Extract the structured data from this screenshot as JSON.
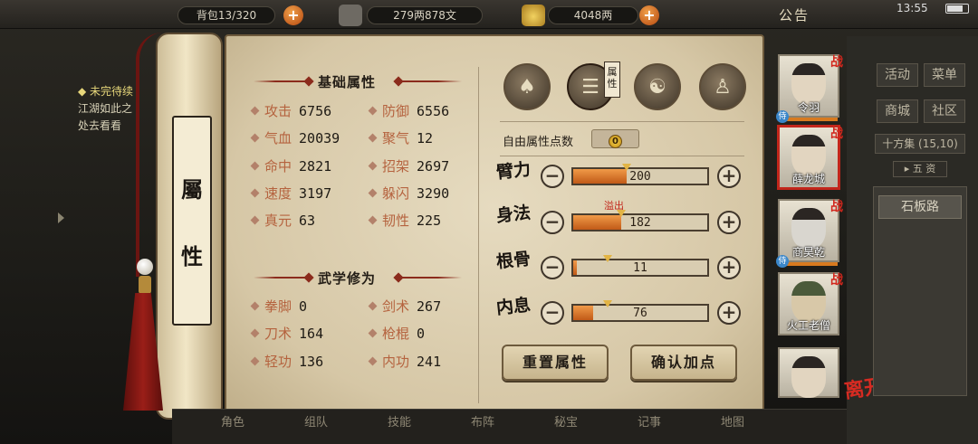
{
  "topbar": {
    "bag_text": "背包13/320",
    "money_text": "279两878文",
    "gold_text": "4048两",
    "notice": "公告",
    "time": "13:55",
    "plus": "+"
  },
  "left_quest": {
    "title": "◆ 未完待续",
    "line1": "江湖如此之",
    "line2": "处去看看"
  },
  "scroll": {
    "label_top": "屬",
    "label_bottom": "性"
  },
  "basic": {
    "title": "基础属性",
    "stats": [
      {
        "name": "攻击",
        "value": "6756"
      },
      {
        "name": "防御",
        "value": "6556"
      },
      {
        "name": "气血",
        "value": "20039"
      },
      {
        "name": "聚气",
        "value": "12"
      },
      {
        "name": "命中",
        "value": "2821"
      },
      {
        "name": "招架",
        "value": "2697"
      },
      {
        "name": "速度",
        "value": "3197"
      },
      {
        "name": "躲闪",
        "value": "3290"
      },
      {
        "name": "真元",
        "value": "63"
      },
      {
        "name": "韧性",
        "value": "225"
      }
    ]
  },
  "martial": {
    "title": "武学修为",
    "stats": [
      {
        "name": "拳脚",
        "value": "0"
      },
      {
        "name": "剑术",
        "value": "267"
      },
      {
        "name": "刀术",
        "value": "164"
      },
      {
        "name": "枪棍",
        "value": "0"
      },
      {
        "name": "轻功",
        "value": "136"
      },
      {
        "name": "内功",
        "value": "241"
      }
    ]
  },
  "tabs": {
    "attr_tag": "属性"
  },
  "free_points": {
    "label": "自由属性点数",
    "value": "0"
  },
  "attributes": [
    {
      "name": "臂力",
      "value": "200",
      "fill": 0.4,
      "marker": 0.4
    },
    {
      "name": "身法",
      "value": "182",
      "fill": 0.36,
      "marker": 0.36,
      "overflow": "溢出"
    },
    {
      "name": "根骨",
      "value": "11",
      "fill": 0.03,
      "marker": 0.26
    },
    {
      "name": "内息",
      "value": "76",
      "fill": 0.15,
      "marker": 0.26
    }
  ],
  "buttons": {
    "reset": "重置属性",
    "confirm": "确认加点"
  },
  "characters": [
    {
      "name": "令羽",
      "tag": "战",
      "badge": "侍"
    },
    {
      "name": "薛龙城",
      "tag": "战"
    },
    {
      "name": "商昊乾",
      "tag": "战",
      "badge": "侍"
    },
    {
      "name": "火工老僧",
      "tag": "战"
    },
    {
      "name": "",
      "tag": ""
    }
  ],
  "leave_label": "离开",
  "right_menu": {
    "activity": "活动",
    "menu": "菜单",
    "shop": "商城",
    "community": "社区",
    "market": "十方集 (15,10)",
    "dropdown": "▸ 五 资",
    "path": "石板路"
  },
  "bottom": [
    "角色",
    "组队",
    "技能",
    "布阵",
    "秘宝",
    "记事",
    "地图"
  ],
  "colors": {
    "accent": "#c15a17",
    "warning": "#c2261b",
    "paper": "#e6dbc0"
  }
}
